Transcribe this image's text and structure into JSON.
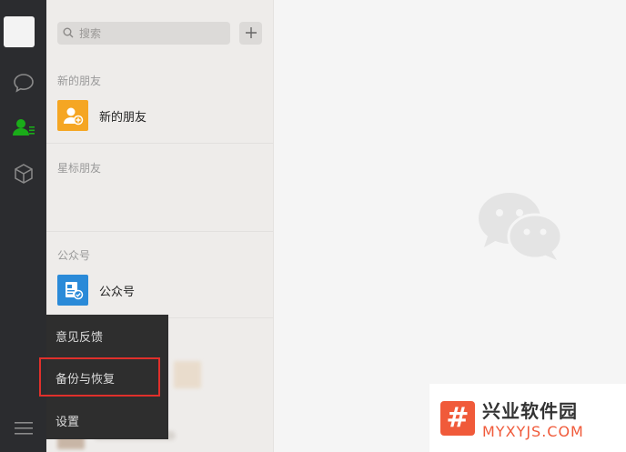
{
  "search": {
    "placeholder": "搜索"
  },
  "sections": {
    "new_friends": "新的朋友",
    "starred": "星标朋友",
    "official": "公众号"
  },
  "rows": {
    "new_friends": "新的朋友",
    "official": "公众号"
  },
  "menu": {
    "items": [
      "意见反馈",
      "备份与恢复",
      "设置"
    ]
  },
  "watermark": {
    "name": "兴业软件园",
    "domain": "MYXYJS.COM",
    "mark": "#"
  },
  "colors": {
    "rail": "#2b2c2f",
    "active_green": "#1aad19",
    "highlight": "#e0302b",
    "new_friend_icon": "#f5a623",
    "official_icon": "#2a8ad8"
  }
}
